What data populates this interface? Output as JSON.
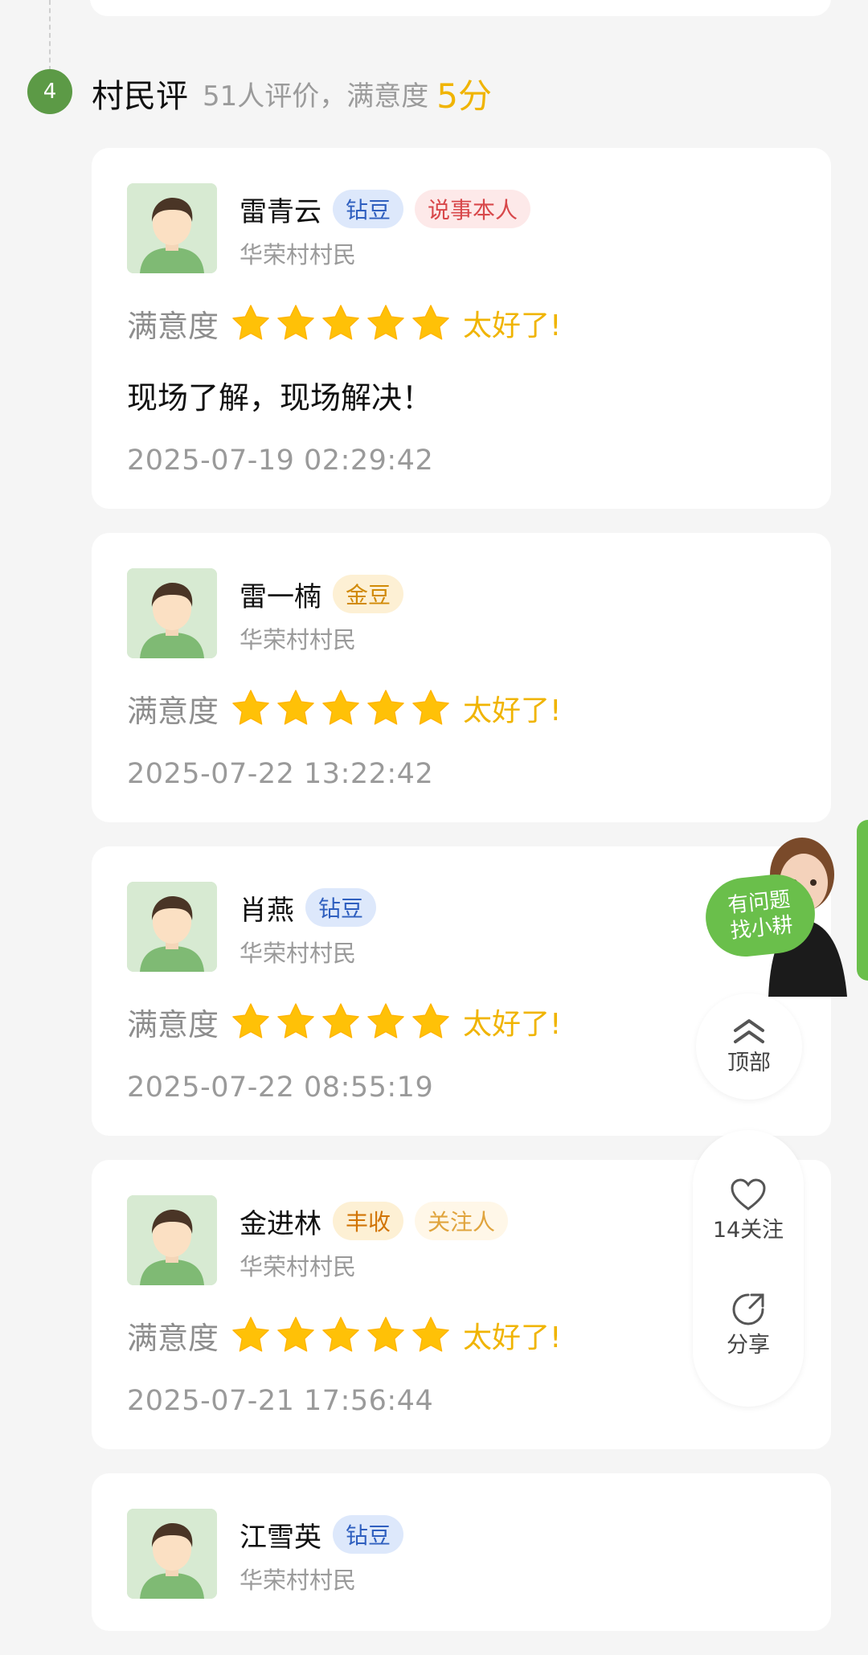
{
  "section": {
    "number": "4",
    "title": "村民评",
    "summary": "51人评价，满意度",
    "score": "5分"
  },
  "reviews": [
    {
      "name": "雷青云",
      "tags": [
        {
          "label": "钻豆",
          "style": "diamond"
        },
        {
          "label": "说事本人",
          "style": "role-red"
        }
      ],
      "village": "华荣村村民",
      "rating_label": "满意度",
      "stars": 5,
      "rating_text": "太好了!",
      "comment": "现场了解，现场解决！",
      "datetime": "2025-07-19 02:29:42"
    },
    {
      "name": "雷一楠",
      "tags": [
        {
          "label": "金豆",
          "style": "gold"
        }
      ],
      "village": "华荣村村民",
      "rating_label": "满意度",
      "stars": 5,
      "rating_text": "太好了!",
      "comment": "",
      "datetime": "2025-07-22 13:22:42"
    },
    {
      "name": "肖燕",
      "tags": [
        {
          "label": "钻豆",
          "style": "diamond"
        }
      ],
      "village": "华荣村村民",
      "rating_label": "满意度",
      "stars": 5,
      "rating_text": "太好了!",
      "comment": "",
      "datetime": "2025-07-22 08:55:19"
    },
    {
      "name": "金进林",
      "tags": [
        {
          "label": "丰收",
          "style": "harvest"
        },
        {
          "label": "关注人",
          "style": "role-orange"
        }
      ],
      "village": "华荣村村民",
      "rating_label": "满意度",
      "stars": 5,
      "rating_text": "太好了!",
      "comment": "",
      "datetime": "2025-07-21 17:56:44"
    },
    {
      "name": "江雪英",
      "tags": [
        {
          "label": "钻豆",
          "style": "diamond"
        }
      ],
      "village": "华荣村村民",
      "rating_label": "",
      "stars": 0,
      "rating_text": "",
      "comment": "",
      "datetime": ""
    }
  ],
  "assistant": {
    "bubble_line1": "有问题",
    "bubble_line2": "找小耕"
  },
  "float_buttons": {
    "top_label": "顶部",
    "follow_label": "14关注",
    "share_label": "分享"
  },
  "icons": {
    "top": "double-chevron-up-icon",
    "follow": "heart-icon",
    "share": "share-icon",
    "star": "star-icon"
  },
  "colors": {
    "accent_green": "#5c9a46",
    "star_yellow": "#ffc107",
    "score_yellow": "#f0b400",
    "bubble_green": "#6abf4b"
  }
}
